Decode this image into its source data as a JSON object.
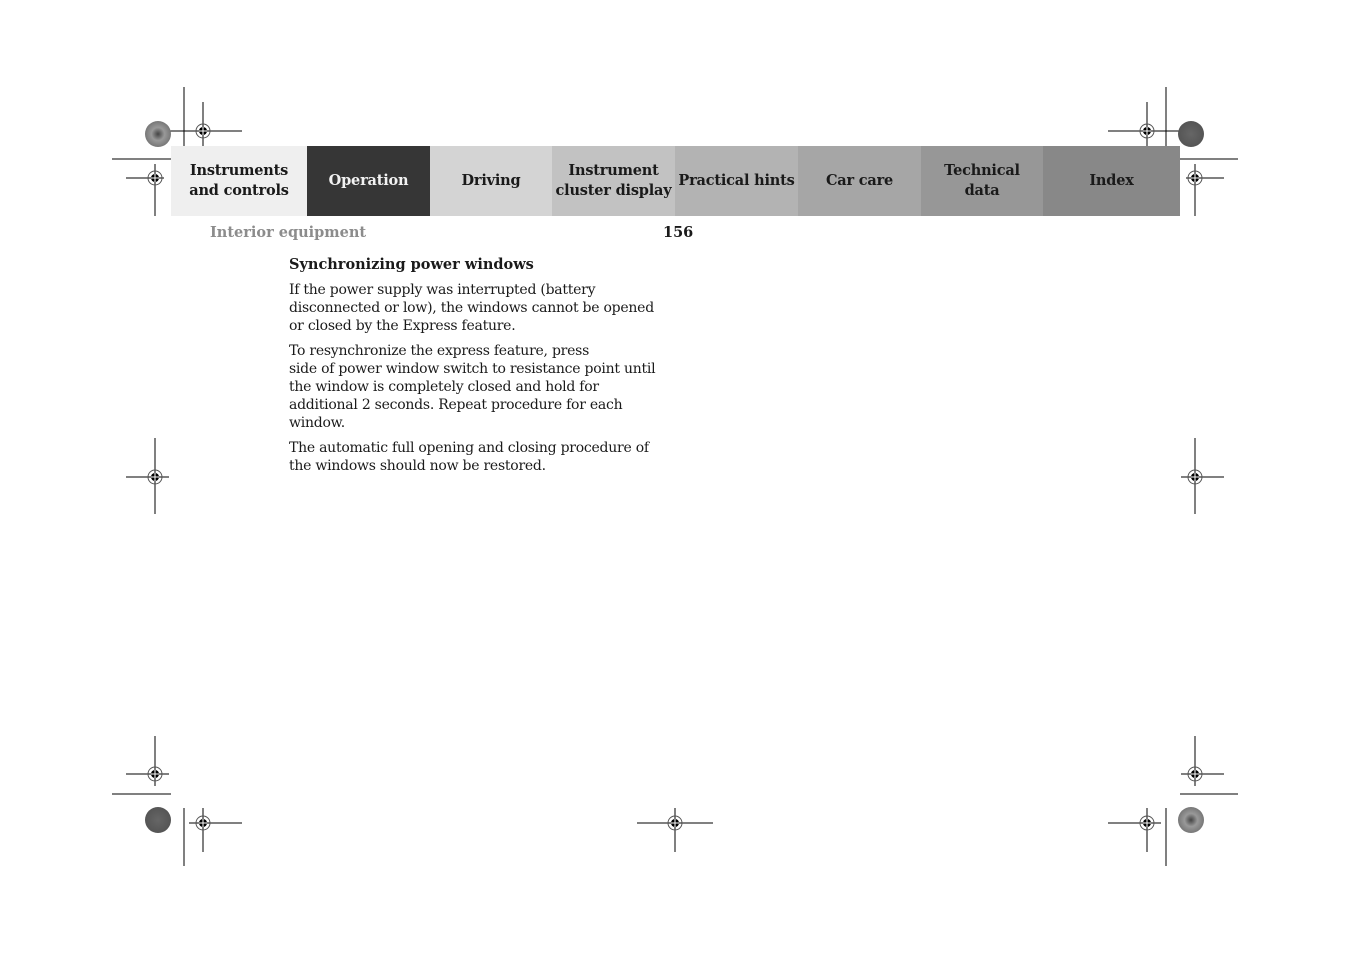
{
  "nav": {
    "tabs": [
      {
        "label": "Instruments\nand controls",
        "active": false
      },
      {
        "label": "Operation",
        "active": true
      },
      {
        "label": "Driving",
        "active": false
      },
      {
        "label": "Instrument\ncluster display",
        "active": false
      },
      {
        "label": "Practical hints",
        "active": false
      },
      {
        "label": "Car care",
        "active": false
      },
      {
        "label": "Technical\ndata",
        "active": false
      },
      {
        "label": "Index",
        "active": false
      }
    ]
  },
  "header": {
    "section": "Interior equipment",
    "page_number": "156"
  },
  "content": {
    "heading": "Synchronizing power windows",
    "paragraphs": [
      "If the power supply was interrupted (battery disconnected or low), the windows cannot be opened or closed by the Express feature.",
      "To resynchronize the express feature, press           side of power window switch to resistance point until the window is completely closed and hold for additional 2 seconds. Repeat procedure for each window.",
      "The automatic full opening and closing procedure of the windows should now be restored."
    ]
  },
  "colors": {
    "active_tab": "#363636",
    "section_label": "#8c8c8c"
  }
}
